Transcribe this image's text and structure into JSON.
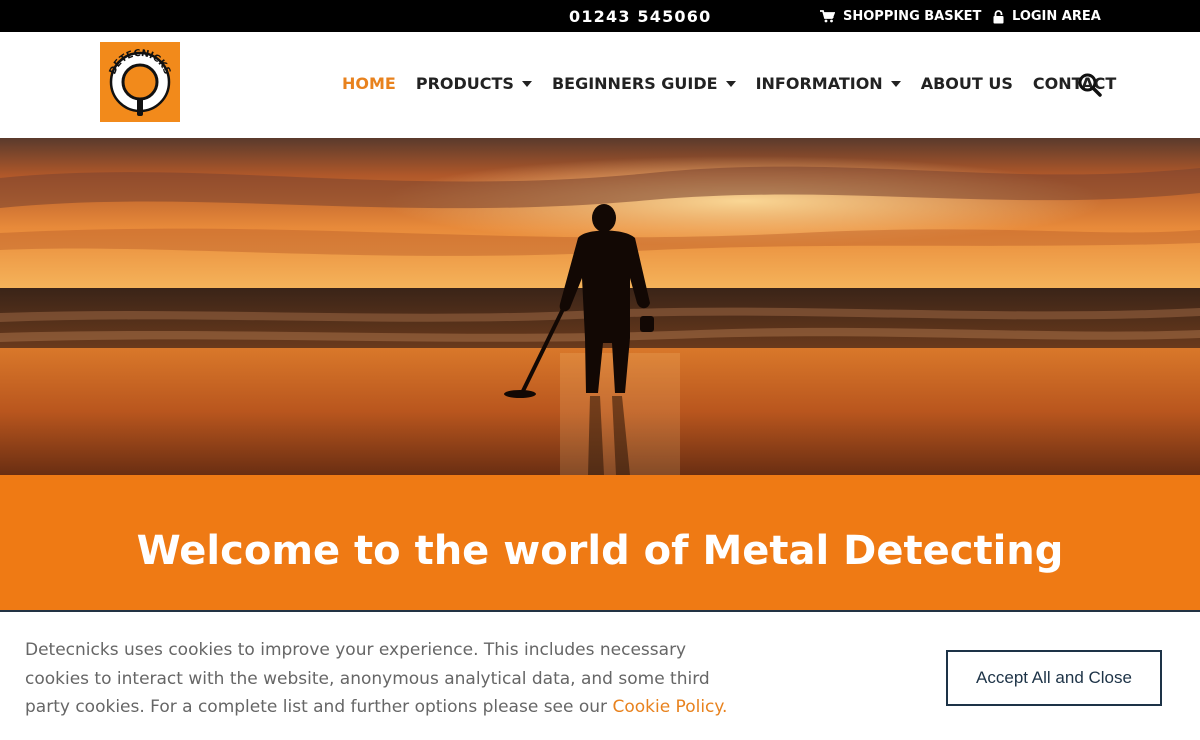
{
  "topbar": {
    "phone": "01243 545060",
    "basket_label": "SHOPPING BASKET",
    "login_label": "LOGIN AREA"
  },
  "logo": {
    "text": "DETECNICKS",
    "brand_color": "#f28a1b"
  },
  "nav": {
    "items": [
      {
        "label": "HOME",
        "active": true,
        "dropdown": false
      },
      {
        "label": "PRODUCTS",
        "active": false,
        "dropdown": true
      },
      {
        "label": "BEGINNERS GUIDE",
        "active": false,
        "dropdown": true
      },
      {
        "label": "INFORMATION",
        "active": false,
        "dropdown": true
      },
      {
        "label": "ABOUT US",
        "active": false,
        "dropdown": false
      },
      {
        "label": "CONTACT",
        "active": false,
        "dropdown": false
      }
    ]
  },
  "icons": {
    "basket": "cart-icon",
    "login": "lock-icon",
    "search": "search-icon",
    "dropdown": "caret-down-icon"
  },
  "band": {
    "title": "Welcome to the world of Metal Detecting",
    "color": "#ef7a14"
  },
  "cookie": {
    "text": "Detecnicks uses cookies to improve your experience. This includes necessary cookies to interact with the website, anonymous analytical data, and some third party cookies. For a complete list and further options please see our ",
    "link_label": "Cookie Policy",
    "link_suffix": ".",
    "accept_label": "Accept All and Close"
  },
  "colors": {
    "accent": "#e8821e",
    "dark_navy": "#1d3347"
  }
}
